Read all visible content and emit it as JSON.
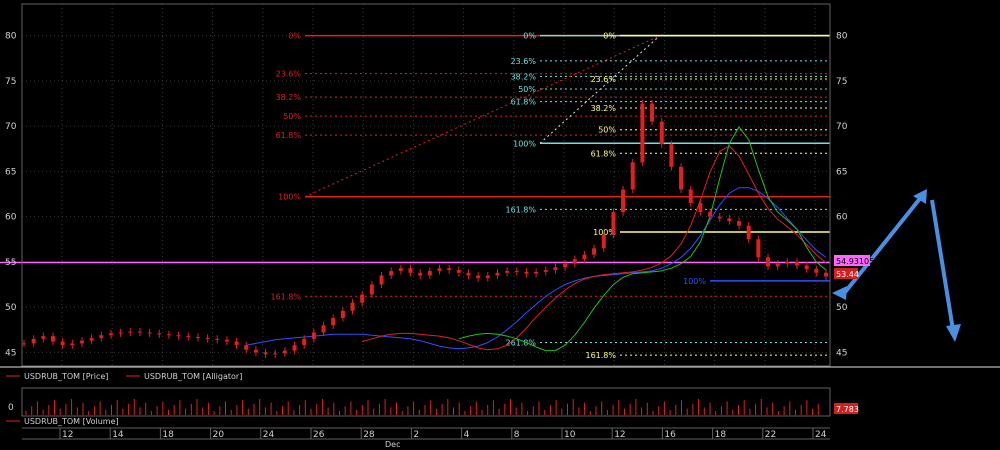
{
  "chart_data": {
    "type": "line",
    "instrument": "USDRUB_TOM",
    "price_axis": {
      "range": [
        43.5,
        81.5
      ],
      "ticks": [
        80,
        75,
        70,
        65,
        60,
        55,
        50,
        45
      ]
    },
    "volume_axis": {
      "ticks": [
        0
      ]
    },
    "time_axis": {
      "tick_labels": [
        "12",
        "14",
        "18",
        "20",
        "24",
        "26",
        "28",
        "2",
        "4",
        "8",
        "10",
        "12",
        "16",
        "18",
        "22",
        "24"
      ],
      "month_label": "Dec",
      "month_at_label": "2"
    },
    "legend": [
      {
        "name": "USDRUB_TOM [Price]",
        "color": "#e02020"
      },
      {
        "name": "USDRUB_TOM [Alligator]",
        "color": "#e02020"
      },
      {
        "name": "USDRUB_TOM [Volume]",
        "color": "#e02020"
      }
    ],
    "price_labels": [
      {
        "value": "54.93105",
        "color": "#ff66ff",
        "price": 54.93
      },
      {
        "value": "53.44",
        "color": "#ff3030",
        "price": 53.44
      },
      {
        "value": "7.783",
        "color": "#ff3030"
      }
    ],
    "series": [
      {
        "name": "Price",
        "color": "#e02020",
        "style": "candles",
        "values": [
          46.0,
          46.5,
          46.8,
          46.2,
          45.8,
          46.0,
          46.3,
          46.6,
          46.9,
          47.1,
          47.2,
          47.3,
          47.2,
          47.1,
          47.0,
          46.9,
          46.8,
          46.7,
          46.6,
          46.5,
          46.4,
          46.2,
          45.8,
          45.3,
          45.0,
          44.8,
          44.9,
          45.2,
          45.8,
          46.5,
          47.2,
          48.0,
          48.8,
          49.6,
          50.5,
          51.4,
          52.5,
          53.5,
          54.0,
          54.3,
          53.8,
          53.5,
          54.0,
          54.3,
          54.1,
          53.8,
          53.5,
          53.2,
          53.5,
          53.8,
          54.0,
          53.9,
          53.7,
          53.9,
          54.1,
          54.4,
          54.8,
          55.3,
          55.8,
          56.5,
          58.0,
          60.5,
          63.0,
          66.0,
          72.5,
          70.5,
          68.0,
          65.5,
          63.0,
          61.5,
          60.5,
          60.0,
          59.8,
          59.5,
          59.0,
          57.5,
          55.5,
          54.5,
          54.8,
          55.0,
          54.6,
          54.2,
          53.8,
          53.4
        ]
      },
      {
        "name": "Alligator jaw",
        "color": "#3050ff",
        "values": [
          45.8,
          46.0,
          46.2,
          46.4,
          46.5,
          46.6,
          46.7,
          46.8,
          46.9,
          47.0,
          47.0,
          47.0,
          47.0,
          46.9,
          46.8,
          46.7,
          46.6,
          46.5,
          46.3,
          46.0,
          45.7,
          45.5,
          45.4,
          45.5,
          45.7,
          46.1,
          46.7,
          47.5,
          48.4,
          49.4,
          50.3,
          51.2,
          51.9,
          52.5,
          52.9,
          53.2,
          53.4,
          53.5,
          53.6,
          53.7,
          53.8,
          53.9,
          54.0,
          54.3,
          54.8,
          55.5,
          56.5,
          57.9,
          59.6,
          61.3,
          62.6,
          63.2,
          63.2,
          62.8,
          62.0,
          61.0,
          59.8,
          58.6,
          57.4,
          56.3,
          55.5
        ]
      },
      {
        "name": "Alligator teeth",
        "color": "#e02020",
        "values": [
          46.2,
          46.5,
          46.8,
          47.0,
          47.1,
          47.1,
          47.0,
          46.9,
          46.8,
          46.6,
          46.3,
          45.9,
          45.5,
          45.3,
          45.4,
          45.8,
          46.6,
          47.7,
          48.9,
          50.0,
          51.0,
          51.9,
          52.6,
          53.1,
          53.4,
          53.6,
          53.7,
          53.8,
          53.9,
          54.1,
          54.4,
          54.9,
          55.7,
          57.0,
          59.0,
          61.8,
          64.9,
          67.2,
          67.8,
          66.7,
          64.7,
          62.6,
          60.9,
          59.7,
          58.9,
          58.0,
          56.9,
          55.8,
          54.9
        ]
      },
      {
        "name": "Alligator lips",
        "color": "#20c020",
        "values": [
          46.5,
          46.8,
          47.0,
          47.1,
          47.0,
          46.8,
          46.5,
          46.1,
          45.6,
          45.2,
          45.2,
          45.8,
          46.9,
          48.3,
          49.9,
          51.3,
          52.5,
          53.3,
          53.7,
          53.8,
          53.9,
          54.0,
          54.3,
          54.8,
          55.6,
          57.2,
          60.0,
          64.2,
          68.1,
          69.9,
          68.5,
          65.2,
          62.2,
          60.5,
          59.6,
          58.6,
          56.6,
          55.0,
          54.1
        ]
      }
    ],
    "fibonacci_sets": [
      {
        "color": "#e02020",
        "levels": [
          {
            "label": "0%",
            "price": 80.0
          },
          {
            "label": "23.6%",
            "price": 75.8
          },
          {
            "label": "38.2%",
            "price": 73.2
          },
          {
            "label": "50%",
            "price": 71.1
          },
          {
            "label": "61.8%",
            "price": 69.0
          },
          {
            "label": "100%",
            "price": 62.2
          },
          {
            "label": "161.8%",
            "price": 51.2
          }
        ]
      },
      {
        "color": "#70e0e0",
        "levels": [
          {
            "label": "0%",
            "price": 80.0
          },
          {
            "label": "23.6%",
            "price": 77.2
          },
          {
            "label": "38.2%",
            "price": 75.5
          },
          {
            "label": "50%",
            "price": 74.1
          },
          {
            "label": "61.8%",
            "price": 72.7
          },
          {
            "label": "100%",
            "price": 68.1
          },
          {
            "label": "161.8%",
            "price": 60.8
          },
          {
            "label": "261.8%",
            "price": 46.1
          }
        ]
      },
      {
        "color": "#ffff80",
        "levels": [
          {
            "label": "0%",
            "price": 80.0
          },
          {
            "label": "23.6%",
            "price": 75.2
          },
          {
            "label": "38.2%",
            "price": 72.0
          },
          {
            "label": "50%",
            "price": 69.6
          },
          {
            "label": "61.8%",
            "price": 67.0
          },
          {
            "label": "100%",
            "price": 58.3
          },
          {
            "label": "161.8%",
            "price": 44.7
          }
        ]
      },
      {
        "color": "#3050ff",
        "levels": [
          {
            "label": "100%",
            "price": 52.9
          }
        ]
      }
    ],
    "horizontal_lines": [
      {
        "price": 54.93,
        "color": "#ff66ff"
      },
      {
        "price": 62.2,
        "color": "#e02020"
      }
    ]
  }
}
